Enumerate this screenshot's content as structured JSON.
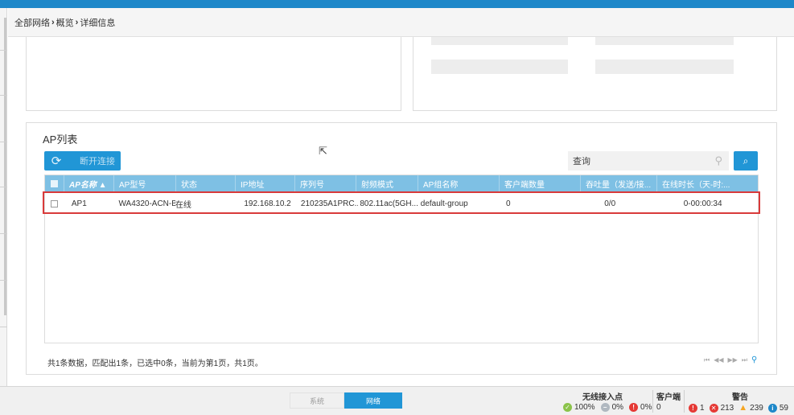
{
  "breadcrumb": {
    "items": [
      "全部网络",
      "概览",
      "详细信息"
    ],
    "separator": "›"
  },
  "ap_list": {
    "title": "AP列表",
    "disconnect_label": "断开连接",
    "search_value": "查询",
    "columns": [
      "AP名称 ▲",
      "AP型号",
      "状态",
      "IP地址",
      "序列号",
      "射频模式",
      "AP组名称",
      "客户端数量",
      "吞吐量（发送/接...",
      "在线时长（天-时:..."
    ],
    "rows": [
      [
        "AP1",
        "WA4320-ACN-B",
        "在线",
        "192.168.10.2",
        "210235A1PRC...",
        "802.11ac(5GH...",
        "default-group",
        "0",
        "0/0",
        "0-00:00:34"
      ]
    ],
    "summary": "共1条数据，匹配出1条，已选中0条，当前为第1页，共1页。",
    "pager": [
      "⏮",
      "◀◀",
      "▶▶",
      "⏭"
    ]
  },
  "bottom": {
    "tab_system": "系统",
    "tab_network": "网络",
    "wireless_ap": {
      "title": "无线接入点",
      "online": "100%",
      "offline": "0%",
      "fault": "0%"
    },
    "clients": {
      "title": "客户端",
      "count": "0"
    },
    "alarms": {
      "title": "警告",
      "critical": "1",
      "major": "213",
      "minor": "239",
      "info": "59"
    }
  },
  "colors": {
    "accent": "#2196d6",
    "header": "#7ec0e4",
    "highlight": "#d93a3a"
  }
}
